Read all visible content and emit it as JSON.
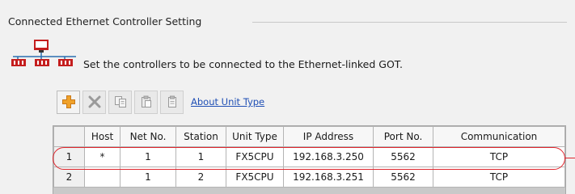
{
  "group": {
    "title": "Connected Ethernet Controller Setting"
  },
  "description": "Set the controllers to be connected to the Ethernet-linked GOT.",
  "toolbar": {
    "buttons": [
      {
        "icon": "add-icon"
      },
      {
        "icon": "delete-icon"
      },
      {
        "icon": "copy-icon"
      },
      {
        "icon": "paste-icon"
      },
      {
        "icon": "clipboard-icon"
      }
    ],
    "about_link": "About Unit Type"
  },
  "table": {
    "columns": [
      "",
      "Host",
      "Net No.",
      "Station",
      "Unit Type",
      "IP Address",
      "Port No.",
      "Communication"
    ],
    "rows": [
      {
        "num": "1",
        "host": "*",
        "net_no": "1",
        "station": "1",
        "unit_type": "FX5CPU",
        "ip": "192.168.3.250",
        "port": "5562",
        "comm": "TCP"
      },
      {
        "num": "2",
        "host": "",
        "net_no": "1",
        "station": "2",
        "unit_type": "FX5CPU",
        "ip": "192.168.3.251",
        "port": "5562",
        "comm": "TCP"
      }
    ]
  },
  "colors": {
    "highlight": "#e0262d",
    "link": "#1f4fb5",
    "icon_red": "#c41e1e",
    "add_icon": "#f0a22a"
  }
}
